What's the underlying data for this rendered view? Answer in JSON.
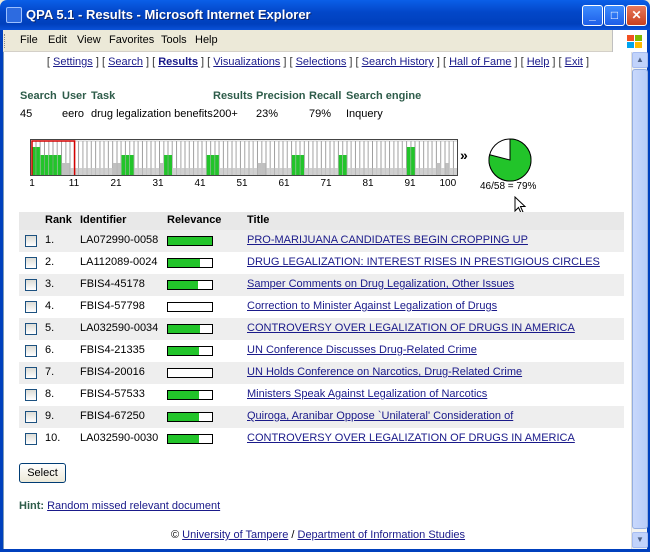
{
  "window": {
    "title": "QPA 5.1 - Results - Microsoft Internet Explorer",
    "minimize": "_",
    "maximize": "□",
    "close": "✕"
  },
  "menu": [
    "File",
    "Edit",
    "View",
    "Favorites",
    "Tools",
    "Help"
  ],
  "nav": {
    "items": [
      "Settings",
      "Search",
      "Results",
      "Visualizations",
      "Selections",
      "Search History",
      "Hall of Fame",
      "Help",
      "Exit"
    ],
    "current": "Results"
  },
  "summary": {
    "headers": {
      "search": "Search",
      "user": "User",
      "task": "Task",
      "results": "Results",
      "precision": "Precision",
      "recall": "Recall",
      "engine": "Search engine"
    },
    "values": {
      "search": "45",
      "user": "eero",
      "task": "drug legalization benefits",
      "results": "200+",
      "precision": "23%",
      "recall": "79%",
      "engine": "Inquery"
    }
  },
  "relevance_bars": {
    "ticks": [
      "1",
      "11",
      "21",
      "31",
      "41",
      "51",
      "61",
      "71",
      "81",
      "91",
      "100"
    ],
    "levels": [
      3,
      3,
      2,
      2,
      2,
      2,
      2,
      1,
      1,
      0,
      0,
      0,
      0,
      0,
      0,
      0,
      0,
      0,
      0,
      1,
      1,
      2,
      2,
      2,
      0,
      0,
      0,
      0,
      0,
      0,
      1,
      2,
      2,
      0,
      0,
      0,
      0,
      0,
      0,
      0,
      0,
      2,
      2,
      2,
      0,
      0,
      0,
      0,
      0,
      0,
      0,
      0,
      0,
      1,
      1,
      0,
      0,
      0,
      0,
      0,
      0,
      2,
      2,
      2,
      0,
      0,
      0,
      0,
      0,
      0,
      0,
      0,
      2,
      2,
      0,
      0,
      0,
      0,
      0,
      0,
      0,
      0,
      0,
      0,
      0,
      0,
      0,
      0,
      3,
      3,
      0,
      0,
      0,
      0,
      0,
      1,
      0,
      1,
      0,
      0
    ],
    "more": "»",
    "highlight_range": "1-11"
  },
  "pie": {
    "label": "46/58 = 79%",
    "recall_fraction": 0.79
  },
  "table": {
    "headers": {
      "rank": "Rank",
      "identifier": "Identifier",
      "relevance": "Relevance",
      "title": "Title"
    },
    "rows": [
      {
        "rank": "1.",
        "identifier": "LA072990-0058",
        "relevance": 1.0,
        "title": "PRO-MARIJUANA CANDIDATES BEGIN CROPPING UP"
      },
      {
        "rank": "2.",
        "identifier": "LA112089-0024",
        "relevance": 0.72,
        "title": "DRUG LEGALIZATION: INTEREST RISES IN PRESTIGIOUS CIRCLES"
      },
      {
        "rank": "3.",
        "identifier": "FBIS4-45178",
        "relevance": 0.68,
        "title": "Samper Comments on Drug Legalization, Other Issues"
      },
      {
        "rank": "4.",
        "identifier": "FBIS4-57798",
        "relevance": 0.0,
        "title": "Correction to Minister Against Legalization of Drugs"
      },
      {
        "rank": "5.",
        "identifier": "LA032590-0034",
        "relevance": 0.72,
        "title": "CONTROVERSY OVER LEGALIZATION OF DRUGS IN AMERICA"
      },
      {
        "rank": "6.",
        "identifier": "FBIS4-21335",
        "relevance": 0.7,
        "title": "UN Conference Discusses Drug-Related Crime"
      },
      {
        "rank": "7.",
        "identifier": "FBIS4-20016",
        "relevance": 0.0,
        "title": "UN Holds Conference on Narcotics, Drug-Related Crime"
      },
      {
        "rank": "8.",
        "identifier": "FBIS4-57533",
        "relevance": 0.7,
        "title": "Ministers Speak Against Legalization of Narcotics"
      },
      {
        "rank": "9.",
        "identifier": "FBIS4-67250",
        "relevance": 0.7,
        "title": "Quiroga, Aranibar Oppose `Unilateral' Consideration of"
      },
      {
        "rank": "10.",
        "identifier": "LA032590-0030",
        "relevance": 0.7,
        "title": "CONTROVERSY OVER LEGALIZATION OF DRUGS IN AMERICA"
      }
    ]
  },
  "select_button": "Select",
  "hint": {
    "label": "Hint:",
    "link": "Random missed relevant document"
  },
  "footer": {
    "copyright": "©",
    "org1": "University of Tampere",
    "sep": "/",
    "org2": "Department of Information Studies"
  },
  "colors": {
    "relevant": "#22c42a",
    "partial": "#c0c0c0",
    "accent_text": "#2e5c4a"
  }
}
